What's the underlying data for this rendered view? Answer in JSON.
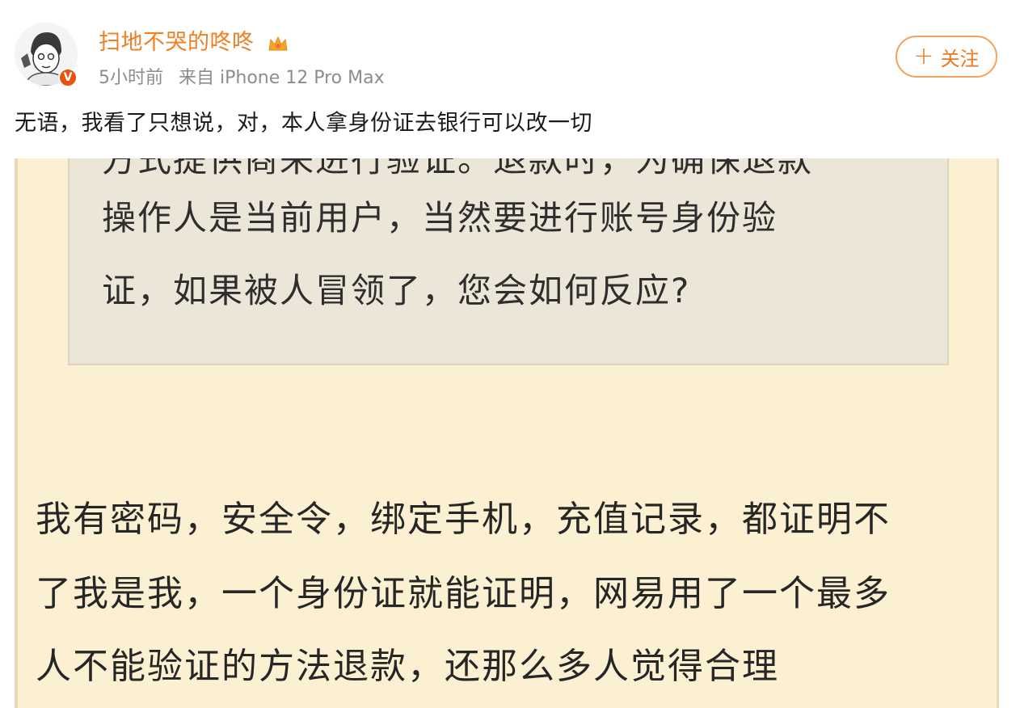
{
  "post": {
    "username": "扫地不哭的咚咚",
    "time": "5小时前",
    "source": "来自 iPhone 12 Pro Max",
    "follow_label": "关注",
    "text": "无语，我看了只想说，对，本人拿身份证去银行可以改一切"
  },
  "screenshot": {
    "quote_lines": [
      "方式提供商来进行验证。退款时，为确保退款",
      "操作人是当前用户，当然要进行账号身份验",
      "证，如果被人冒领了，您会如何反应?"
    ],
    "reply_lines": [
      "我有密码，安全令，绑定手机，充值记录，都证明不",
      "了我是我，一个身份证就能证明，网易用了一个最多",
      "人不能验证的方法退款，还那么多人觉得合理"
    ]
  },
  "colors": {
    "username": "#f07e22",
    "follow_border": "#f5a15a",
    "screenshot_bg": "#fcf0d3",
    "quote_bg": "#ece6d8"
  },
  "icons": {
    "verified": "orange-v-badge",
    "crown": "crown-icon",
    "plus": "plus-icon"
  }
}
